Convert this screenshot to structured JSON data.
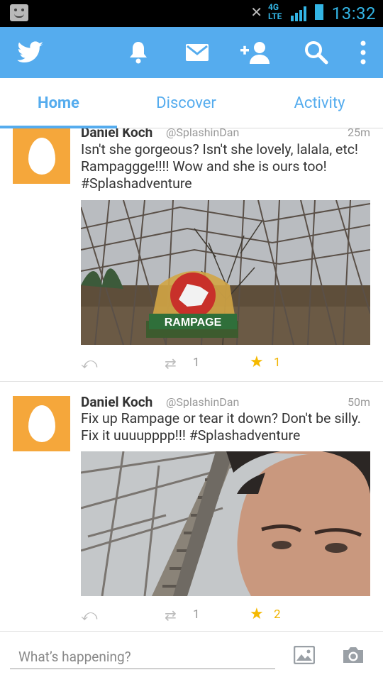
{
  "status_bar": {
    "time": "13:32",
    "network": "4G LTE"
  },
  "tabs": [
    {
      "label": "Home",
      "active": true
    },
    {
      "label": "Discover",
      "active": false
    },
    {
      "label": "Activity",
      "active": false
    }
  ],
  "tweets": [
    {
      "name": "Daniel Koch",
      "handle": "@SplashinDan",
      "time": "25m",
      "text": "Isn't she gorgeous?  Isn't she lovely, lalala, etc!   Rampaggge!!!!  Wow and she is ours too!  #Splashadventure",
      "retweets": "1",
      "favorites": "1",
      "image_caption": "RAMPAGE"
    },
    {
      "name": "Daniel Koch",
      "handle": "@SplashinDan",
      "time": "50m",
      "text": "Fix up Rampage or tear it down?  Don't be silly. Fix it uuuupppp!!!  #Splashadventure",
      "retweets": "1",
      "favorites": "2"
    }
  ],
  "compose": {
    "placeholder": "What’s happening?"
  },
  "colors": {
    "twitter_blue": "#55acee",
    "avatar_orange": "#f5a73b",
    "favorite_gold": "#f5b900"
  }
}
